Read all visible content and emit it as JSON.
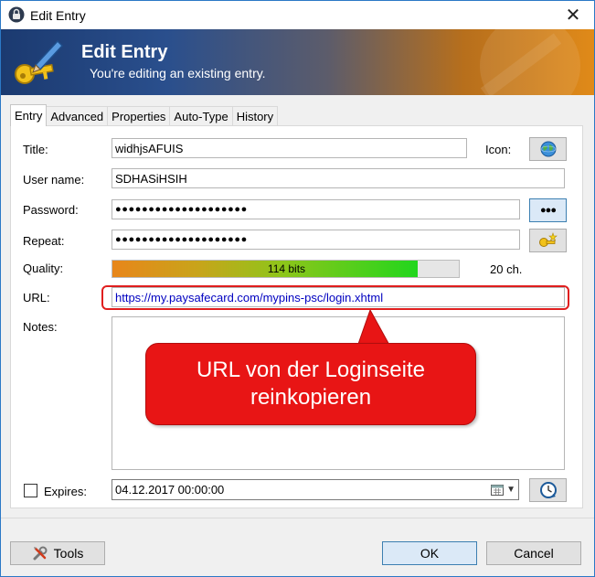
{
  "window": {
    "title": "Edit Entry"
  },
  "banner": {
    "title": "Edit Entry",
    "subtitle": "You're editing an existing entry."
  },
  "tabs": [
    {
      "label": "Entry",
      "active": true
    },
    {
      "label": "Advanced",
      "active": false
    },
    {
      "label": "Properties",
      "active": false
    },
    {
      "label": "Auto-Type",
      "active": false
    },
    {
      "label": "History",
      "active": false
    }
  ],
  "form": {
    "title_label": "Title:",
    "title_value": "widhjsAFUIS",
    "icon_label": "Icon:",
    "username_label": "User name:",
    "username_value": "SDHASiHSIH",
    "password_label": "Password:",
    "password_value": "●●●●●●●●●●●●●●●●●●●●",
    "show_password_label": "●●●",
    "repeat_label": "Repeat:",
    "repeat_value": "●●●●●●●●●●●●●●●●●●●●",
    "quality_label": "Quality:",
    "quality_text": "114 bits",
    "quality_fraction": 0.88,
    "quality_chars": "20 ch.",
    "url_label": "URL:",
    "url_value": "https://my.paysafecard.com/mypins-psc/login.xhtml",
    "notes_label": "Notes:",
    "expires_label": "Expires:",
    "expires_checked": false,
    "expires_value": "04.12.2017 00:00:00"
  },
  "callout": {
    "line1": "URL von der Loginseite",
    "line2": "reinkopieren",
    "color": "#e81515"
  },
  "footer": {
    "tools_label": "Tools",
    "ok_label": "OK",
    "cancel_label": "Cancel"
  },
  "icons": {
    "app": "lock-icon",
    "banner": "key-pen-icon",
    "entry_icon": "globe-icon",
    "generate": "key-star-icon",
    "expiry_presets": "clock-icon",
    "tools": "wrench-icon",
    "calendar": "calendar-icon"
  }
}
